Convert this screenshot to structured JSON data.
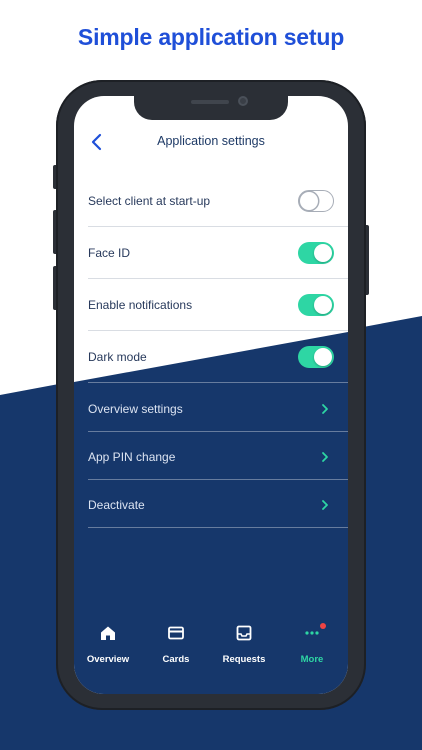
{
  "headline": "Simple application setup",
  "colors": {
    "headline": "#1f4fd8",
    "navy": "#16376b",
    "accent_green": "#2ed6a4",
    "badge_red": "#ef4444"
  },
  "screen": {
    "title": "Application settings",
    "back_icon": "chevron-left-icon"
  },
  "settings": [
    {
      "label": "Select client at start-up",
      "control": "toggle",
      "state": "off"
    },
    {
      "label": "Face ID",
      "control": "toggle",
      "state": "on"
    },
    {
      "label": "Enable notifications",
      "control": "toggle",
      "state": "on"
    },
    {
      "label": "Dark mode",
      "control": "toggle",
      "state": "on"
    },
    {
      "label": "Overview settings",
      "control": "chevron"
    },
    {
      "label": "App PIN change",
      "control": "chevron"
    },
    {
      "label": "Deactivate",
      "control": "chevron"
    }
  ],
  "tabs": [
    {
      "label": "Overview",
      "icon": "home-icon",
      "active": false
    },
    {
      "label": "Cards",
      "icon": "card-icon",
      "active": false
    },
    {
      "label": "Requests",
      "icon": "inbox-icon",
      "active": false
    },
    {
      "label": "More",
      "icon": "more-dots-icon",
      "active": true,
      "badge": true
    }
  ]
}
